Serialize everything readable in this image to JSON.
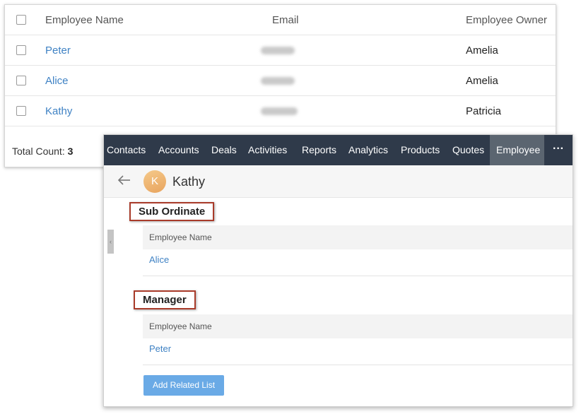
{
  "employee_list": {
    "columns": [
      "Employee Name",
      "Email",
      "Employee Owner"
    ],
    "rows": [
      {
        "name": "Peter",
        "owner": "Amelia"
      },
      {
        "name": "Alice",
        "owner": "Amelia"
      },
      {
        "name": "Kathy",
        "owner": "Patricia"
      }
    ],
    "total_label": "Total Count:",
    "total_value": "3"
  },
  "nav": {
    "items": [
      "Contacts",
      "Accounts",
      "Deals",
      "Activities",
      "Reports",
      "Analytics",
      "Products",
      "Quotes",
      "Employee"
    ],
    "active": "Employee",
    "more": "···"
  },
  "record": {
    "avatar_initial": "K",
    "name": "Kathy"
  },
  "sections": [
    {
      "title": "Sub Ordinate",
      "column": "Employee Name",
      "value": "Alice"
    },
    {
      "title": "Manager",
      "column": "Employee Name",
      "value": "Peter"
    }
  ],
  "add_related_list": "Add Related List",
  "handle_glyph": "‹",
  "colors": {
    "nav_bg": "#2f3a4a",
    "nav_active": "#5b6570",
    "link": "#3f82c4",
    "highlight_border": "#a93b2a",
    "button": "#6aaae6"
  }
}
